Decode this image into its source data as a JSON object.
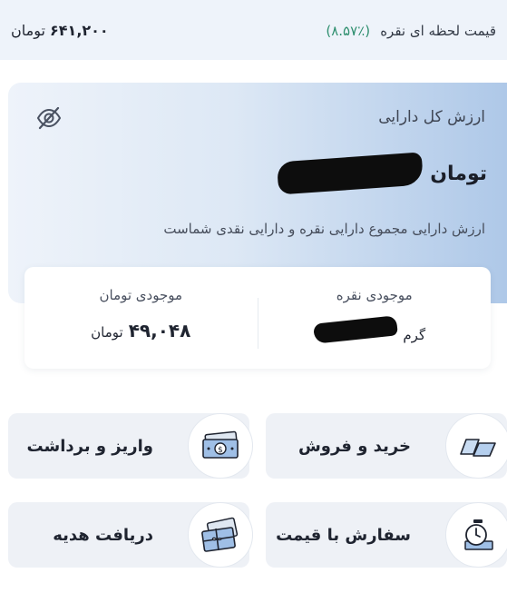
{
  "price_bar": {
    "label": "قیمت لحظه ای نقره",
    "change": "(٪۸.۵۷)",
    "value": "۶۴۱,۲۰۰",
    "currency": "تومان"
  },
  "asset_card": {
    "title": "ارزش کل دارایی",
    "currency": "تومان",
    "description": "ارزش دارایی مجموع دارایی نقره و دارایی نقدی شماست",
    "hide_icon": "eye-off-icon"
  },
  "balances": {
    "silver": {
      "title": "موجودی نقره",
      "unit": "گرم"
    },
    "toman": {
      "title": "موجودی تومان",
      "value": "۴۹,۰۴۸",
      "currency": "تومان"
    }
  },
  "actions": [
    {
      "label": "خرید و فروش",
      "icon": "silver-bars-icon"
    },
    {
      "label": "واریز و برداشت",
      "icon": "cash-icon"
    },
    {
      "label": "سفارش با قیمت",
      "icon": "timer-icon"
    },
    {
      "label": "دریافت هدیه",
      "icon": "gift-card-icon"
    }
  ],
  "colors": {
    "accent_green": "#2f8f6f",
    "card_blue": "#aec8e8",
    "bar_bg": "#eef3fa",
    "tile_bg": "#eef1f6"
  }
}
